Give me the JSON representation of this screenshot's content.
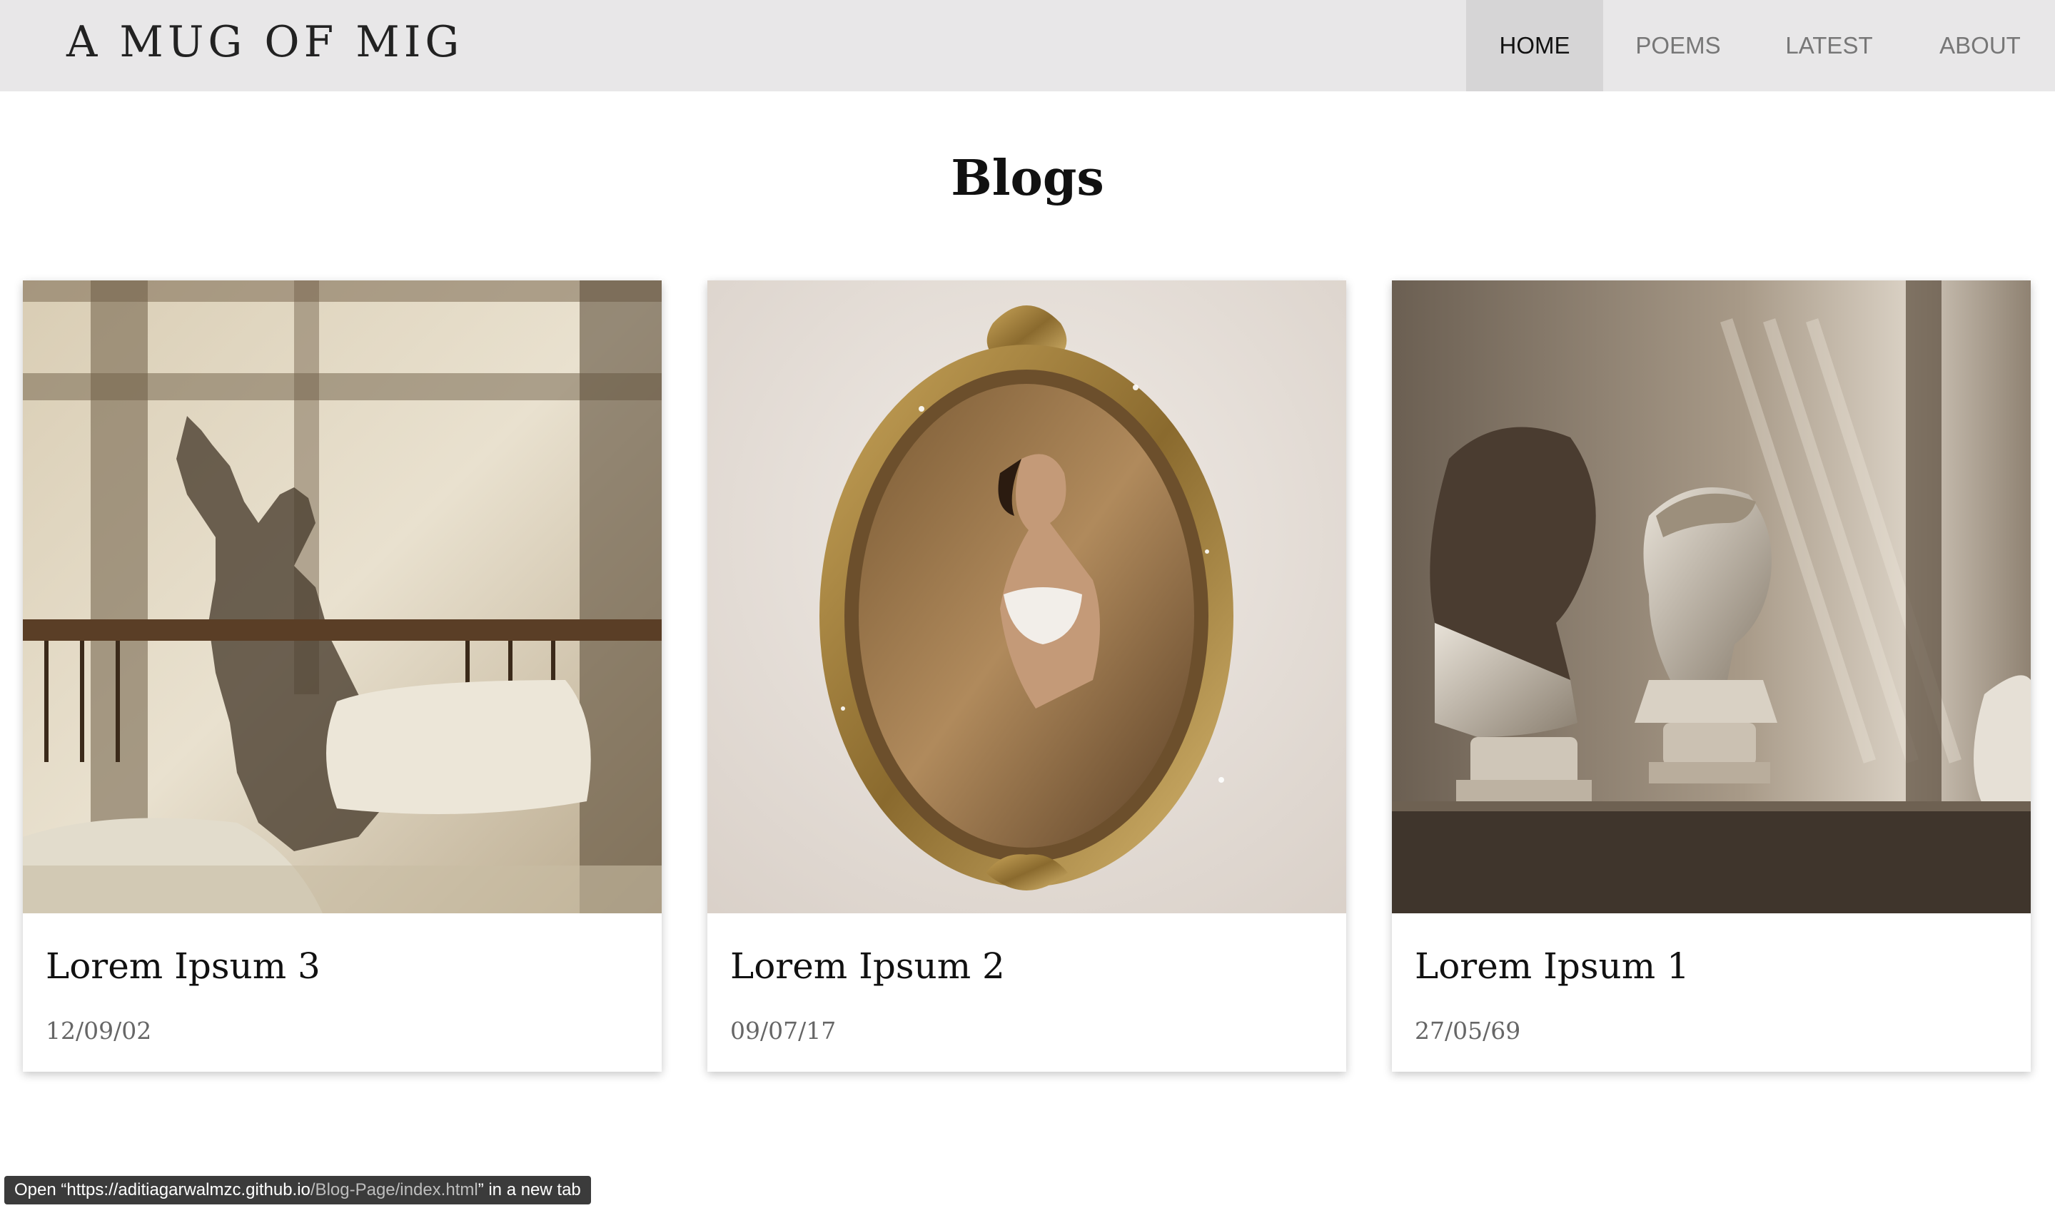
{
  "site": {
    "logo": "A MUG OF MIG"
  },
  "nav": {
    "home": "HOME",
    "poems": "POEMS",
    "latest": "LATEST",
    "about": "ABOUT"
  },
  "main": {
    "title": "Blogs"
  },
  "cards": [
    {
      "title": "Lorem Ipsum 3",
      "date": "12/09/02",
      "image": "shadow-silhouette-bed-photo"
    },
    {
      "title": "Lorem Ipsum 2",
      "date": "09/07/17",
      "image": "ornate-gold-mirror-photo"
    },
    {
      "title": "Lorem Ipsum 1",
      "date": "27/05/69",
      "image": "marble-busts-photo"
    }
  ],
  "status_bar": {
    "prefix": "Open “",
    "url_host": "https://aditiagarwalmzc.github.io",
    "url_path": "/Blog-Page/index.html",
    "suffix": "” in a new tab"
  },
  "colors": {
    "navbar_bg": "#e8e7e8",
    "nav_active_bg": "#d6d5d6",
    "page_bg": "#ffffff"
  }
}
